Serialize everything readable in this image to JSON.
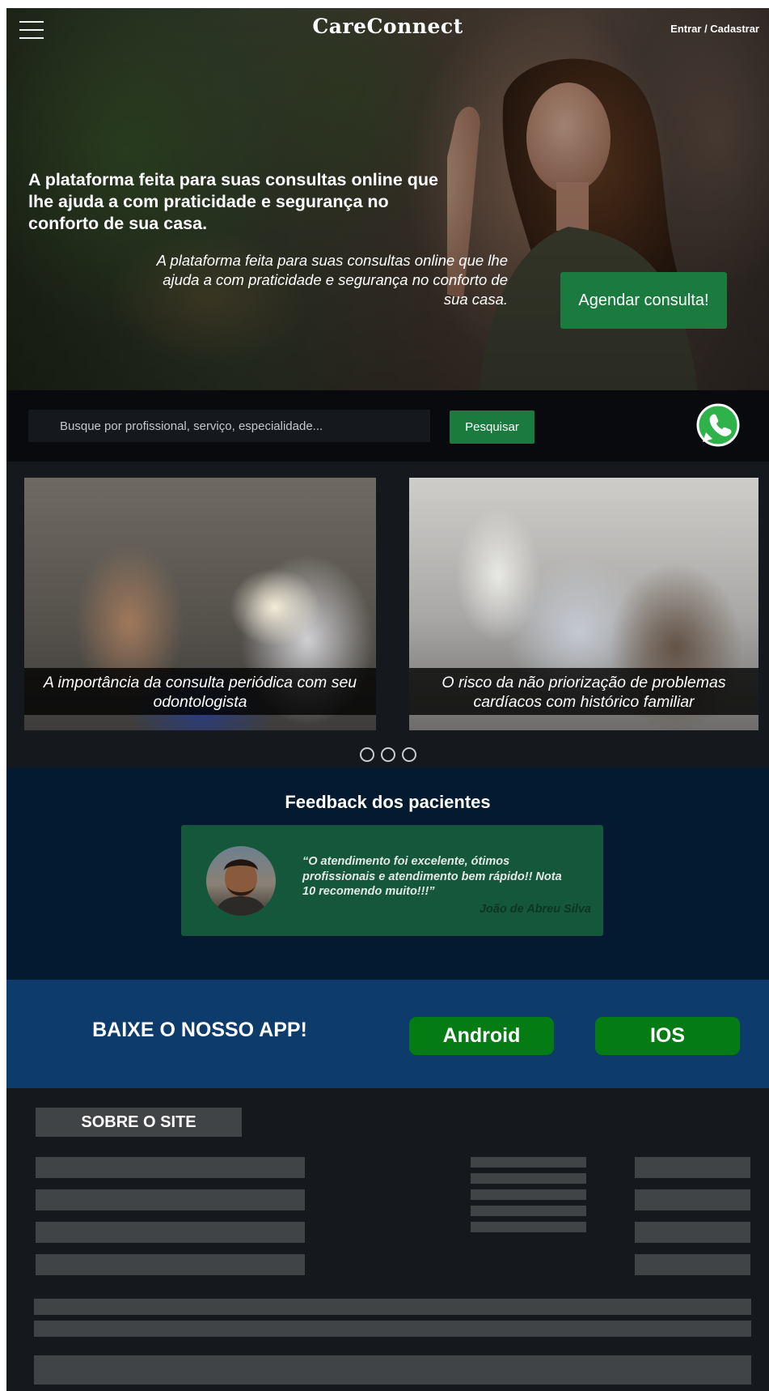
{
  "header": {
    "brand": "CareConnect",
    "login_label": "Entrar / Cadastrar",
    "menu_icon": "hamburger-menu-icon"
  },
  "hero": {
    "title": "A plataforma feita para suas consultas online que lhe ajuda a com praticidade e segurança no conforto de sua casa.",
    "subtitle": "A plataforma feita para suas consultas online que lhe ajuda a com praticidade e segurança no conforto de sua casa.",
    "cta_label": "Agendar consulta!"
  },
  "search": {
    "placeholder": "Busque por profissional, serviço, especialidade...",
    "value": "",
    "button_label": "Pesquisar",
    "whatsapp_icon": "whatsapp-icon"
  },
  "articles": [
    {
      "caption": "A importância da consulta periódica com seu odontologista"
    },
    {
      "caption": "O risco da não priorização de problemas cardíacos com histórico familiar"
    }
  ],
  "carousel": {
    "dots": 3
  },
  "feedback": {
    "title": "Feedback dos pacientes",
    "quote": "“O atendimento foi excelente, ótimos profissionais e atendimento bem rápido!! Nota 10 recomendo muito!!!”",
    "author": "João de Abreu Silva"
  },
  "app": {
    "title": "BAIXE O NOSSO APP!",
    "android_label": "Android",
    "ios_label": "IOS"
  },
  "footer": {
    "heading": "SOBRE O SITE"
  },
  "colors": {
    "accent_green": "#1b7a3e",
    "store_green": "#047b13",
    "feedback_bg": "#041a30",
    "app_bg": "#0c3b6c",
    "footer_bg": "#15181d"
  }
}
